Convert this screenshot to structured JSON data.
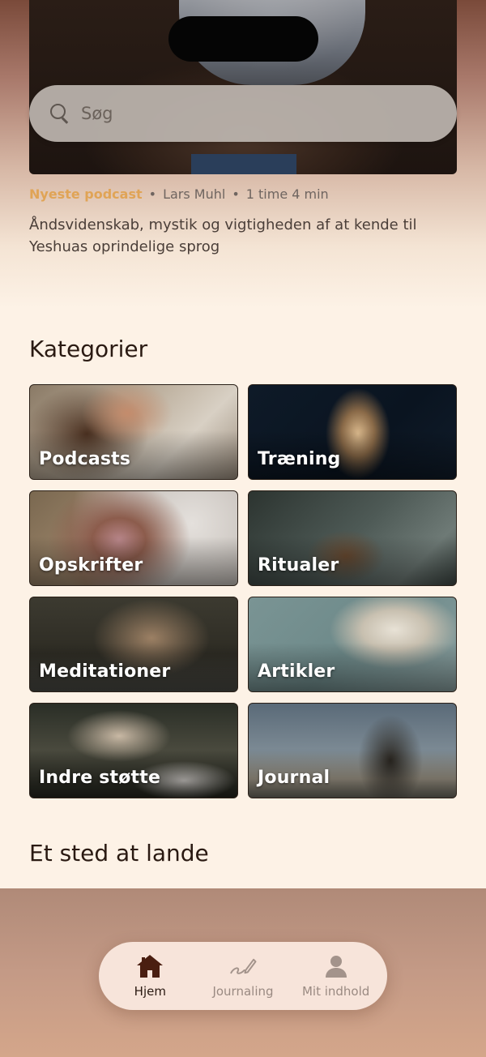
{
  "search": {
    "placeholder": "Søg"
  },
  "featured": {
    "tag": "Nyeste podcast",
    "author": "Lars Muhl",
    "duration": "1 time 4 min",
    "title": "Åndsvidenskab, mystik og vigtigheden af at kende til Yeshuas oprindelige sprog",
    "separator": "•"
  },
  "categories": {
    "heading": "Kategorier",
    "items": [
      {
        "label": "Podcasts"
      },
      {
        "label": "Træning"
      },
      {
        "label": "Opskrifter"
      },
      {
        "label": "Ritualer"
      },
      {
        "label": "Meditationer"
      },
      {
        "label": "Artikler"
      },
      {
        "label": "Indre støtte"
      },
      {
        "label": "Journal"
      }
    ]
  },
  "landing": {
    "heading": "Et sted at lande"
  },
  "nav": {
    "items": [
      {
        "label": "Hjem",
        "icon": "home-icon",
        "active": true
      },
      {
        "label": "Journaling",
        "icon": "pen-icon",
        "active": false
      },
      {
        "label": "Mit indhold",
        "icon": "user-icon",
        "active": false
      }
    ]
  },
  "colors": {
    "accent": "#e0a456",
    "background": "#fdf2e6"
  }
}
